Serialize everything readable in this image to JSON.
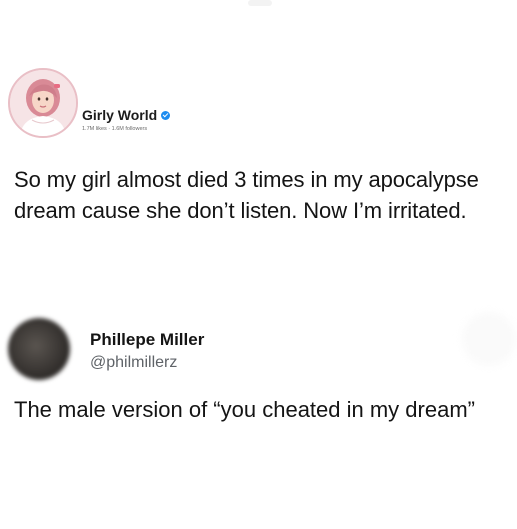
{
  "post1": {
    "name": "Girly World",
    "meta": "1.7M likes · 1.6M followers",
    "text": "So my girl almost died 3 times in my apocalypse dream cause she don’t listen. Now I’m irritated.",
    "verified_icon": "verified-badge-icon",
    "accent_color": "#1d8cf0"
  },
  "post2": {
    "name": "Phillepe Miller",
    "handle": "@philmillerz",
    "text": "The male version of “you cheated in my dream”"
  }
}
